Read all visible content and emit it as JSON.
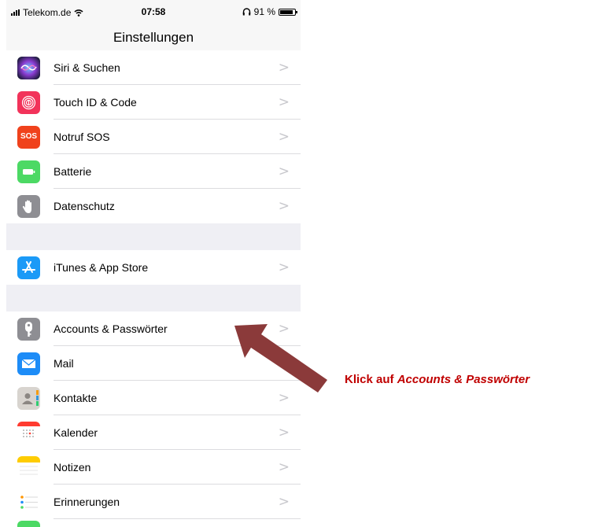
{
  "status_bar": {
    "carrier": "Telekom.de",
    "time": "07:58",
    "battery": "91 %",
    "battery_level": 0.91
  },
  "nav": {
    "title": "Einstellungen"
  },
  "rows": [
    {
      "label": "Siri & Suchen",
      "icon": "siri-icon"
    },
    {
      "label": "Touch ID & Code",
      "icon": "fingerprint-icon"
    },
    {
      "label": "Notruf SOS",
      "icon": "sos-icon",
      "icon_text": "SOS"
    },
    {
      "label": "Batterie",
      "icon": "battery-icon"
    },
    {
      "label": "Datenschutz",
      "icon": "hand-icon"
    },
    {
      "label": "iTunes & App Store",
      "icon": "app-store-icon"
    },
    {
      "label": "Accounts & Passwörter",
      "icon": "key-icon"
    },
    {
      "label": "Mail",
      "icon": "mail-icon"
    },
    {
      "label": "Kontakte",
      "icon": "contacts-icon"
    },
    {
      "label": "Kalender",
      "icon": "calendar-icon"
    },
    {
      "label": "Notizen",
      "icon": "notes-icon"
    },
    {
      "label": "Erinnerungen",
      "icon": "reminders-icon"
    }
  ],
  "chevron": ">",
  "annotation": {
    "prefix": "Klick auf ",
    "emphasis": "Accounts & Passwörter",
    "color": "#c00000"
  },
  "arrow_color": "#8b3a3a"
}
